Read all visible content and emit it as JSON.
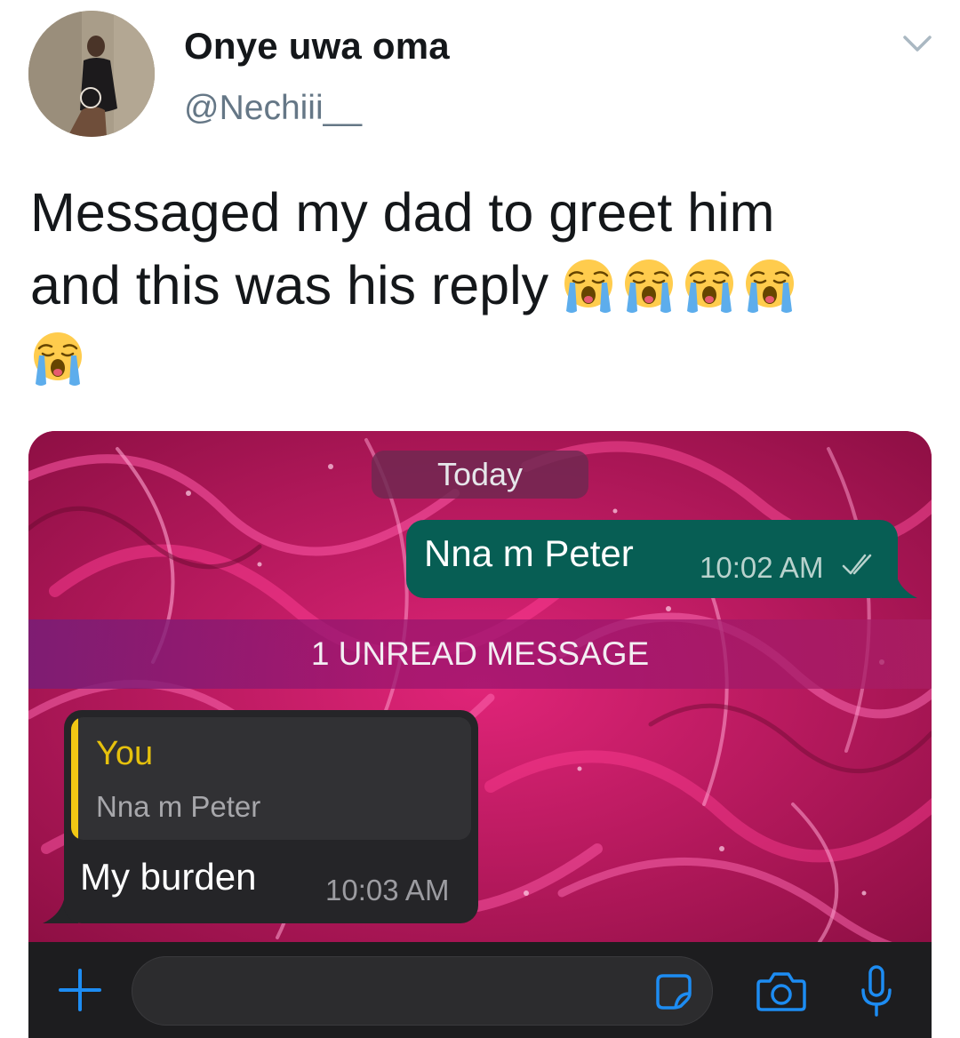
{
  "tweet": {
    "display_name": "Onye uwa oma",
    "handle": "@Nechiii__",
    "text_line1": "Messaged my dad to greet him",
    "text_line2": "and this was his reply",
    "emoji_count": 5,
    "emoji_name": "loudly-crying-face-icon"
  },
  "chat": {
    "date_label": "Today",
    "outgoing": {
      "text": "Nna m Peter",
      "time": "10:02 AM",
      "status_icon": "double-check-icon"
    },
    "unread_label": "1 UNREAD MESSAGE",
    "incoming": {
      "quote_author": "You",
      "quote_text": "Nna m Peter",
      "text": "My burden",
      "time": "10:03 AM"
    },
    "input_bar": {
      "icons": [
        "plus-icon",
        "sticker-icon",
        "camera-icon",
        "microphone-icon"
      ]
    }
  },
  "colors": {
    "outgoing_bubble": "#075e54",
    "incoming_bubble": "#252528",
    "quote_accent": "#f2c714",
    "accent_blue": "#1d8cf2",
    "wallpaper": "#c2185b"
  }
}
